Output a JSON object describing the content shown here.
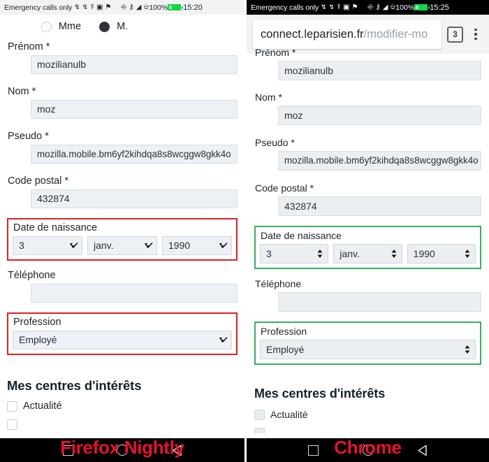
{
  "left": {
    "browser_caption": "Firefox Nightly",
    "status_bar": {
      "carrier": "Emergency calls only",
      "battery_percent": "100%",
      "time": "15:20",
      "icons": [
        "usb-icon",
        "usb-icon",
        "vibrate-icon",
        "screenshot-icon",
        "flag-icon",
        "nfc-icon",
        "vpn-key-icon",
        "wifi-icon",
        "sim-card-icon",
        "battery-icon"
      ]
    },
    "gender": {
      "options": [
        {
          "label": "Mme",
          "selected": false
        },
        {
          "label": "M.",
          "selected": true
        }
      ]
    },
    "fields": [
      {
        "label": "Prénom *",
        "value": "mozilianulb"
      },
      {
        "label": "Nom *",
        "value": "moz"
      },
      {
        "label": "Pseudo *",
        "value": "mozilla.mobile.bm6yf2kihdqa8s8wcggw8gkk4o"
      },
      {
        "label": "Code postal *",
        "value": "432874"
      }
    ],
    "birthdate": {
      "label": "Date de naissance",
      "day": "3",
      "month": "janv.",
      "year": "1990"
    },
    "phone": {
      "label": "Téléphone",
      "value": ""
    },
    "profession": {
      "label": "Profession",
      "value": "Employé"
    },
    "interests": {
      "heading": "Mes centres d'intérêts",
      "items": [
        {
          "label": "Actualité",
          "checked": false
        }
      ]
    },
    "nav": [
      "recents-square-icon",
      "home-circle-icon",
      "back-triangle-icon"
    ]
  },
  "right": {
    "browser_caption": "Chrome",
    "status_bar": {
      "carrier": "Emergency calls only",
      "battery_percent": "100%",
      "time": "15:25",
      "icons": [
        "usb-icon",
        "usb-icon",
        "vibrate-icon",
        "screenshot-icon",
        "flag-icon",
        "nfc-icon",
        "vpn-key-icon",
        "wifi-icon",
        "sim-card-icon",
        "battery-icon"
      ]
    },
    "omnibox": {
      "url_host": "connect.leparisien.fr",
      "url_path": "/modifier-mo",
      "tab_count": "3",
      "menu": "more-options-icon"
    },
    "fields": [
      {
        "label": "Prénom *",
        "value": "mozilianulb"
      },
      {
        "label": "Nom *",
        "value": "moz"
      },
      {
        "label": "Pseudo *",
        "value": "mozilla.mobile.bm6yf2kihdqa8s8wcggw8gkk4o"
      },
      {
        "label": "Code postal *",
        "value": "432874"
      }
    ],
    "birthdate": {
      "label": "Date de naissance",
      "day": "3",
      "month": "janv.",
      "year": "1990"
    },
    "phone": {
      "label": "Téléphone",
      "value": ""
    },
    "profession": {
      "label": "Profession",
      "value": "Employé"
    },
    "interests": {
      "heading": "Mes centres d'intérêts",
      "items": [
        {
          "label": "Actualité",
          "checked": false
        }
      ]
    },
    "nav": [
      "recents-square-icon",
      "home-circle-icon",
      "back-triangle-icon"
    ]
  },
  "colors": {
    "highlight_bad": "#e02020",
    "highlight_good": "#35b15e",
    "caption_red": "#e8132b",
    "battery_green": "#14d44a"
  }
}
